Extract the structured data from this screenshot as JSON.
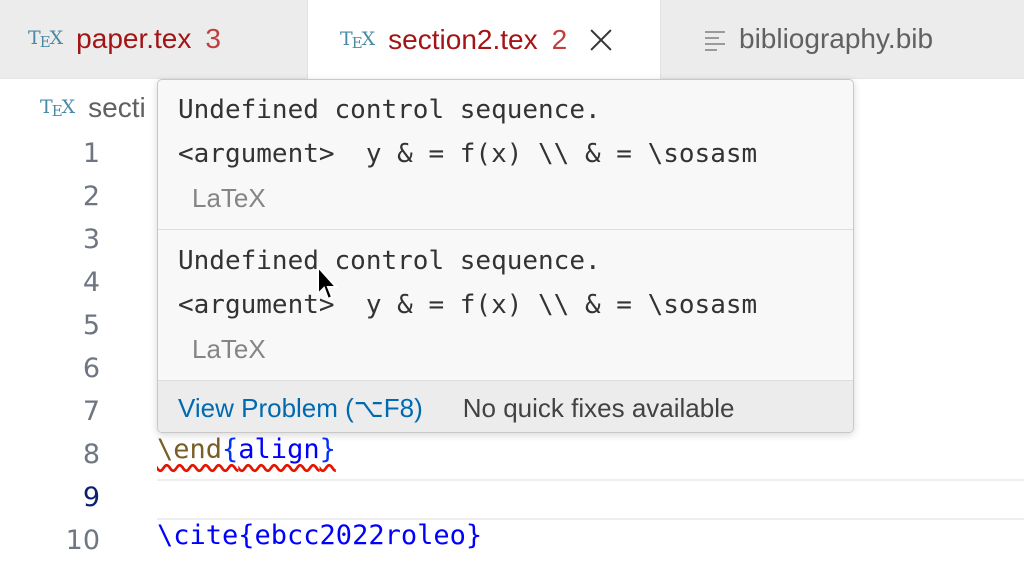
{
  "tabs": [
    {
      "icon": "tex-icon",
      "label": "paper.tex",
      "problems": "3"
    },
    {
      "icon": "tex-icon",
      "label": "section2.tex",
      "problems": "2"
    },
    {
      "icon": "lines-icon",
      "label": "bibliography.bib"
    }
  ],
  "tex_logo": {
    "t": "T",
    "e": "E",
    "x": "X"
  },
  "breadcrumb": {
    "file": "secti"
  },
  "line_numbers": [
    "1",
    "2",
    "3",
    "4",
    "5",
    "6",
    "7",
    "8",
    "9",
    "10"
  ],
  "code": {
    "line8_cmd": "\\end",
    "line8_open": "{",
    "line8_arg": "align",
    "line8_close": "}",
    "line10_partial": "\\cite{ebcc2022roleo}"
  },
  "hover": {
    "problems": [
      {
        "message": "Undefined control sequence.",
        "detail": "<argument>  y & = f(x) \\\\ & = \\sosasm",
        "source": "LaTeX"
      },
      {
        "message": "Undefined control sequence.",
        "detail": "<argument>  y & = f(x) \\\\ & = \\sosasm",
        "source": "LaTeX"
      }
    ],
    "view_problem": "View Problem (⌥F8)",
    "no_fixes": "No quick fixes available"
  },
  "colors": {
    "error": "#e51400",
    "link": "#006ab1",
    "tab_text": "#a31515"
  }
}
